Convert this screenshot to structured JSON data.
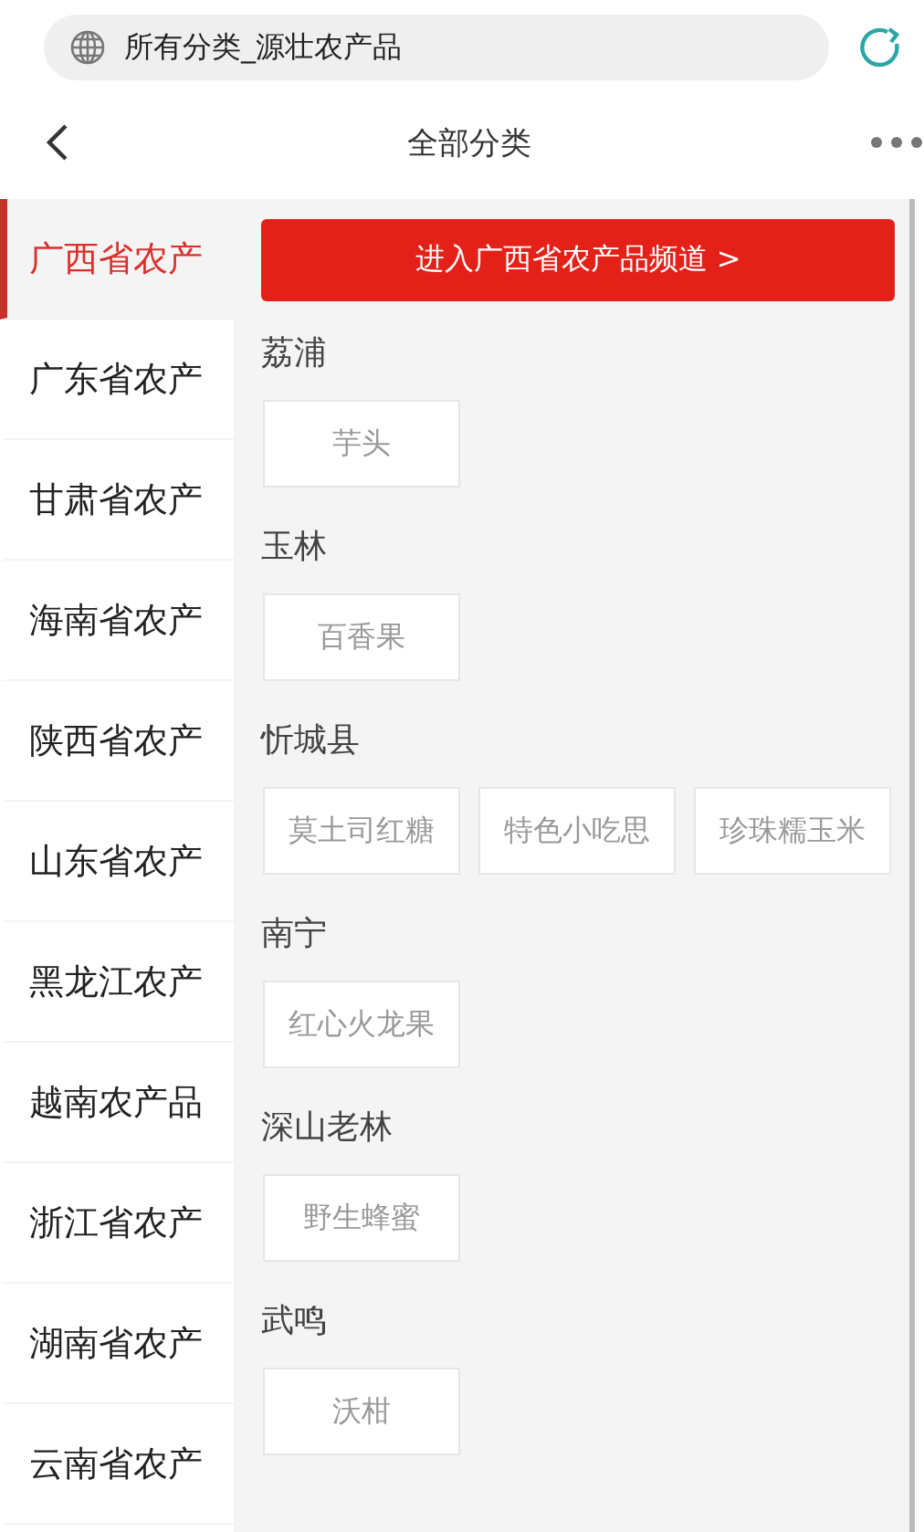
{
  "address_bar": {
    "title": "所有分类_源壮农产品"
  },
  "header": {
    "title": "全部分类"
  },
  "sidebar": {
    "items": [
      {
        "label": "广西省农产",
        "selected": true
      },
      {
        "label": "广东省农产",
        "selected": false
      },
      {
        "label": "甘肃省农产",
        "selected": false
      },
      {
        "label": "海南省农产",
        "selected": false
      },
      {
        "label": "陕西省农产",
        "selected": false
      },
      {
        "label": "山东省农产",
        "selected": false
      },
      {
        "label": "黑龙江农产",
        "selected": false
      },
      {
        "label": "越南农产品",
        "selected": false
      },
      {
        "label": "浙江省农产",
        "selected": false
      },
      {
        "label": "湖南省农产",
        "selected": false
      },
      {
        "label": "云南省农产",
        "selected": false
      }
    ]
  },
  "channel_button": "进入广西省农产品频道 >",
  "groups": [
    {
      "title": "荔浦",
      "items": [
        "芋头"
      ]
    },
    {
      "title": "玉林",
      "items": [
        "百香果"
      ]
    },
    {
      "title": "忻城县",
      "items": [
        "莫土司红糖",
        "特色小吃思",
        "珍珠糯玉米"
      ]
    },
    {
      "title": "南宁",
      "items": [
        "红心火龙果"
      ]
    },
    {
      "title": "深山老林",
      "items": [
        "野生蜂蜜"
      ]
    },
    {
      "title": "武鸣",
      "items": [
        "沃柑"
      ]
    }
  ]
}
